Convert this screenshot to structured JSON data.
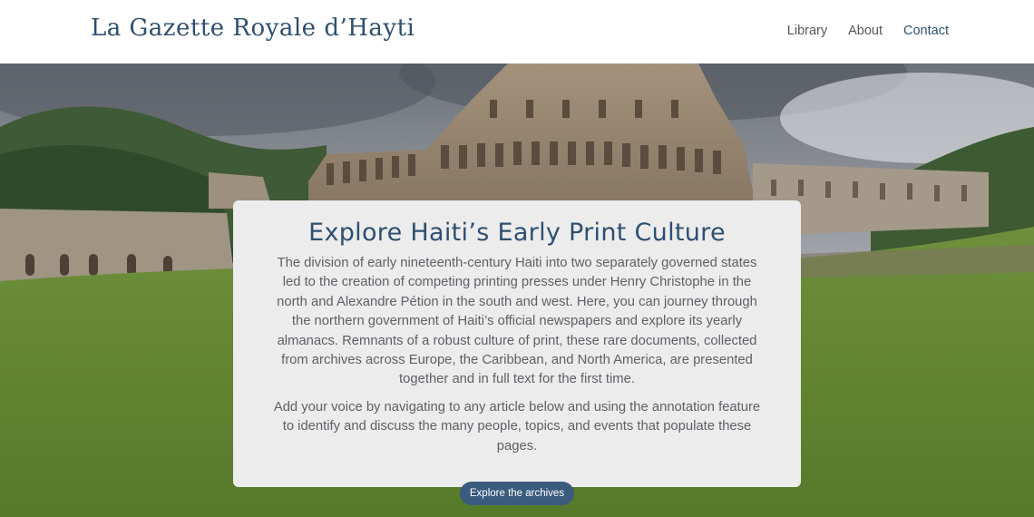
{
  "header": {
    "site_title": "La Gazette Royale d’Hayti",
    "nav": [
      {
        "label": "Library"
      },
      {
        "label": "About"
      },
      {
        "label": "Contact"
      }
    ]
  },
  "card": {
    "title": "Explore Haiti’s Early Print Culture",
    "paragraph_1": "The division of early nineteenth-century Haiti into two separately governed states led to the creation of competing printing presses under Henry Christophe in the north and Alexandre Pétion in the south and west. Here, you can journey through the northern government of Haiti’s official newspapers and explore its yearly almanacs. Remnants of a robust culture of print, these rare documents, collected from archives across Europe, the Caribbean, and North America, are presented together and in full text for the first time.",
    "paragraph_2": "Add your voice by navigating to any article below and using the annotation feature to identify and discuss the many people, topics, and events that populate these pages.",
    "cta_label": "Explore the archives"
  },
  "colors": {
    "brand": "#2e4f72",
    "button": "#3a5a7e",
    "card_bg": "#ececec"
  }
}
